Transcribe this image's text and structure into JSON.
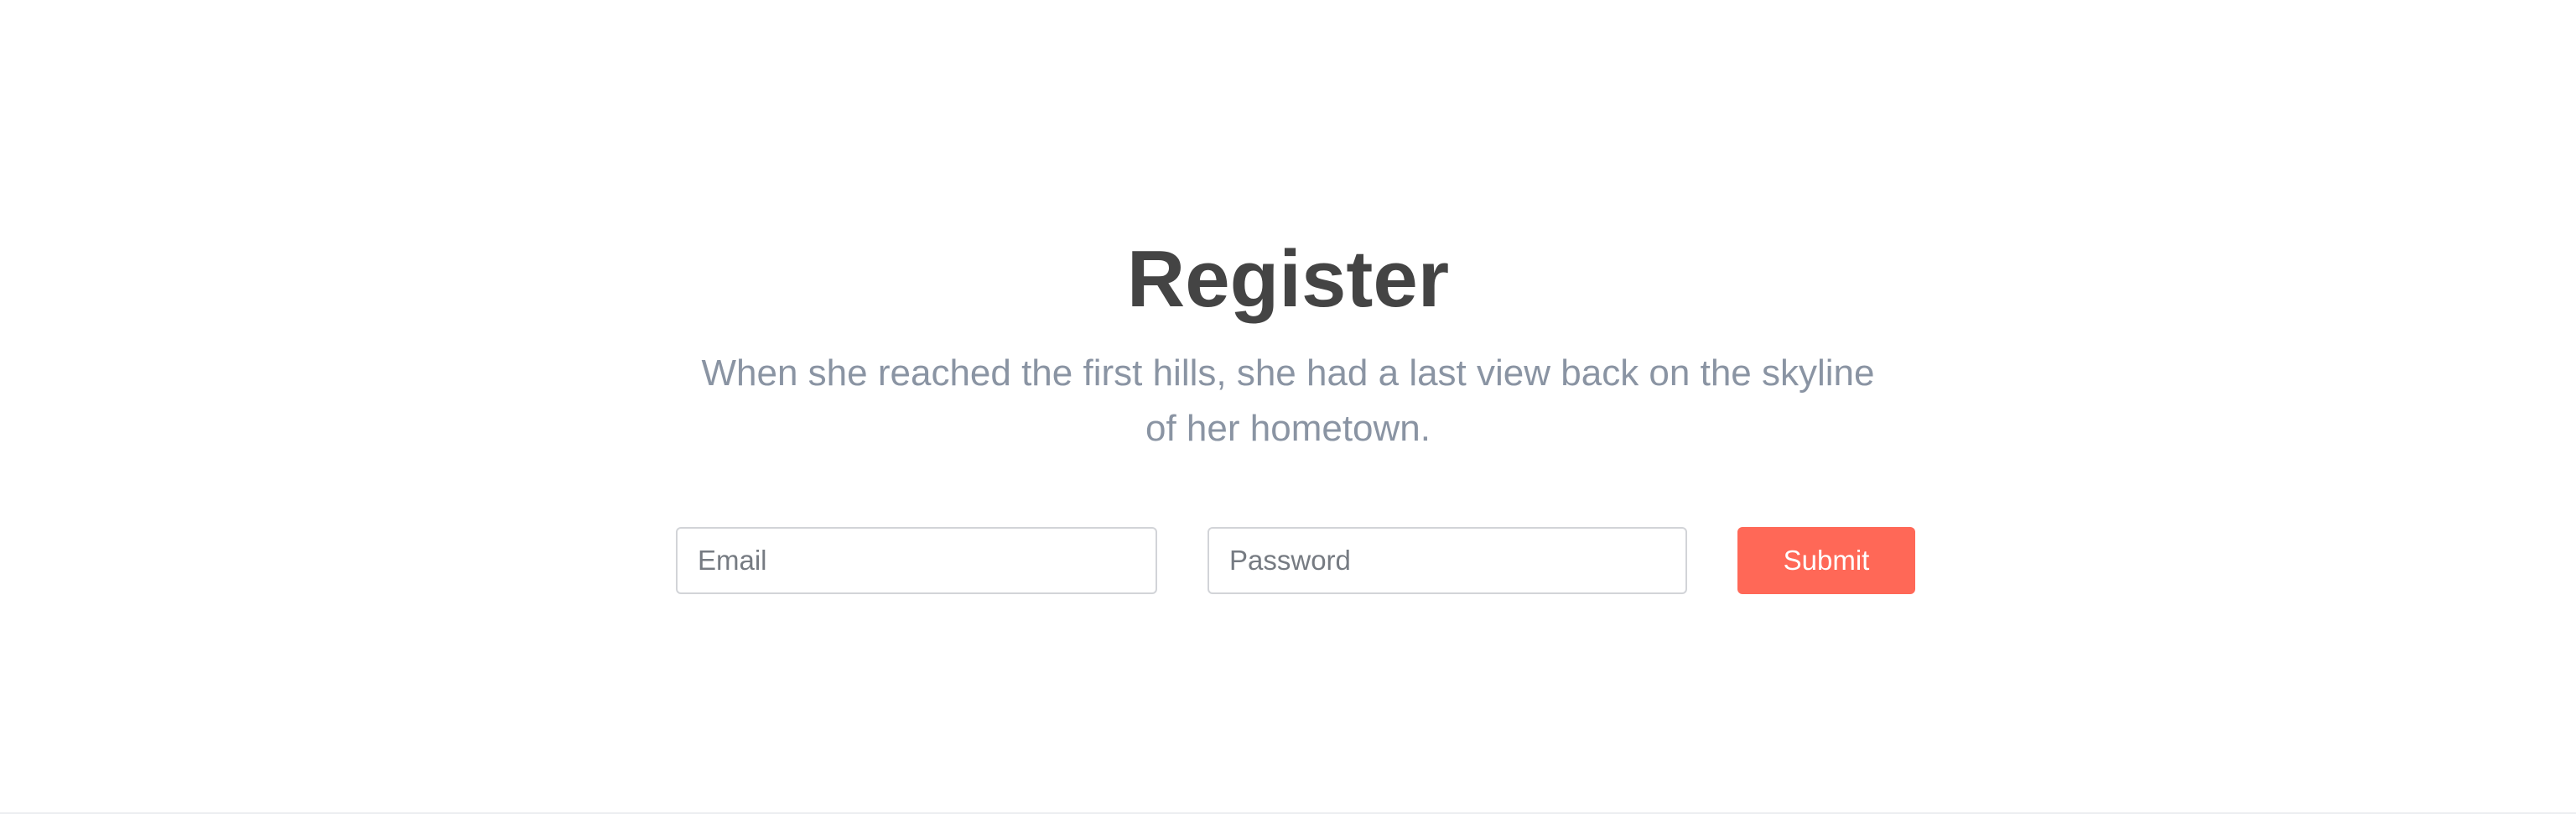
{
  "register": {
    "title": "Register",
    "subtitle_line1": "When she reached the first hills, she had a last view back on the skyline",
    "subtitle_line2": "of her hometown.",
    "email_placeholder": "Email",
    "password_placeholder": "Password",
    "submit_label": "Submit"
  },
  "colors": {
    "accent": "#ff6857",
    "title": "#444444",
    "subtitle": "#8a94a3",
    "input_border": "#d2d4d8"
  }
}
